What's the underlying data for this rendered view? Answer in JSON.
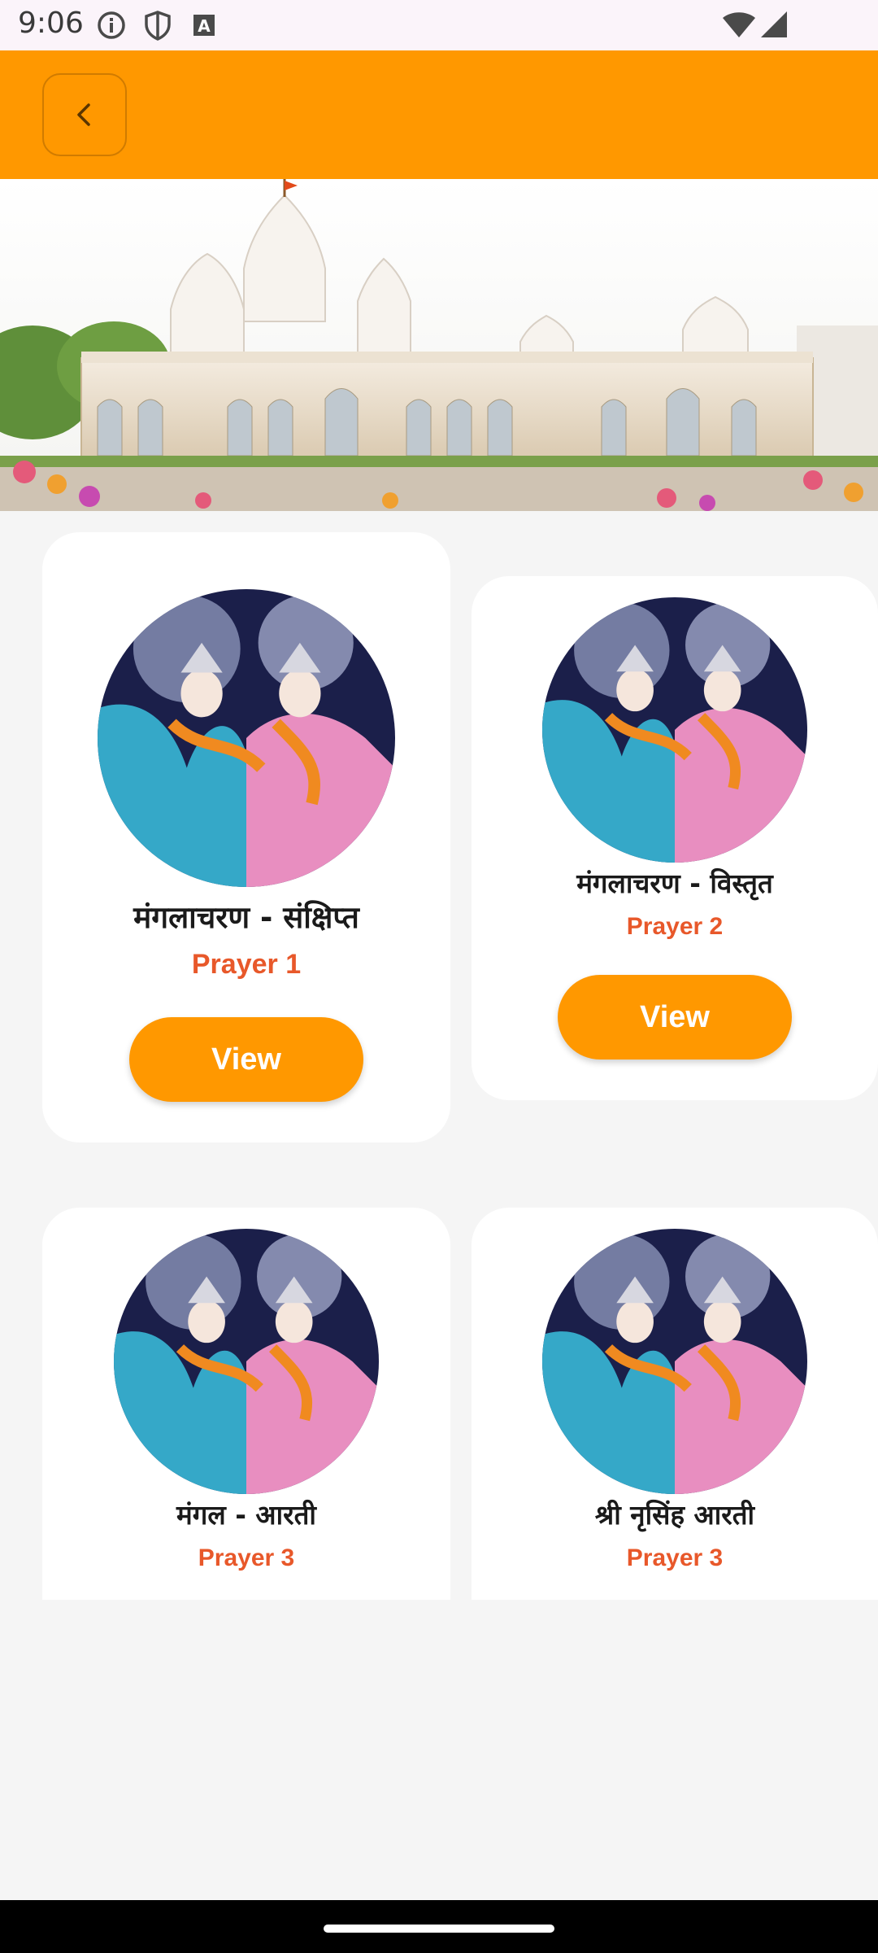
{
  "status_bar": {
    "time": "9:06",
    "icons": [
      "info-icon",
      "shield-icon",
      "font-a-icon",
      "wifi-icon",
      "signal-icon"
    ]
  },
  "app_bar": {
    "back_icon": "chevron-left-icon",
    "color": "#ff9800"
  },
  "banner": {
    "image": "temple-banner"
  },
  "cards": [
    {
      "title": "मंगलाचरण - संक्षिप्त",
      "subtitle": "Prayer 1",
      "button": "View",
      "image": "deity-image"
    },
    {
      "title": "मंगलाचरण - विस्तृत",
      "subtitle": "Prayer 2",
      "button": "View",
      "image": "deity-image"
    },
    {
      "title": "मंगल - आरती",
      "subtitle": "Prayer 3",
      "image": "deity-image"
    },
    {
      "title": "श्री नृसिंह आरती",
      "subtitle": "Prayer 3",
      "image": "deity-image"
    }
  ],
  "colors": {
    "accent": "#ff9800",
    "subtitle": "#e8582a",
    "background": "#f5f5f5"
  }
}
